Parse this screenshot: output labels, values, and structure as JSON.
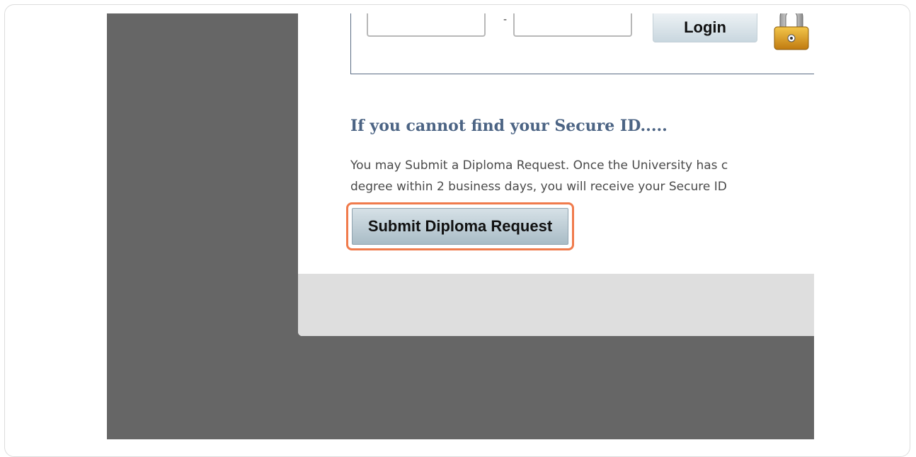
{
  "login": {
    "first_field_value": "",
    "separator": "-",
    "second_field_value": "",
    "button_label": "Login"
  },
  "secure_id_help": {
    "heading": "If you cannot find your Secure ID.....",
    "line1": "You may Submit a Diploma Request. Once the University has c",
    "line2": "degree within 2 business days, you will receive your Secure ID"
  },
  "actions": {
    "submit_label": "Submit Diploma Request"
  },
  "colors": {
    "highlight": "#f07b4c",
    "heading": "#4c6484",
    "background": "#666666"
  },
  "icons": {
    "lock": "padlock-icon"
  }
}
